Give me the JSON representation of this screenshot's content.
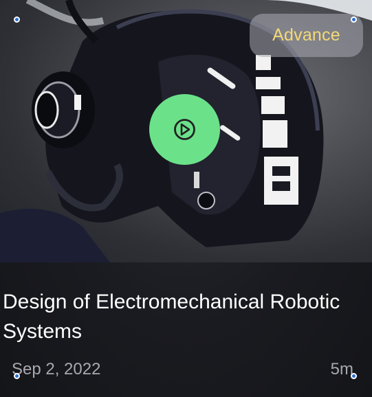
{
  "card": {
    "badge_label": "Advance",
    "title": "Design of Electromechanical Robotic Systems",
    "date": "Sep 2, 2022",
    "duration": "5m"
  },
  "icons": {
    "play": "play-icon"
  },
  "colors": {
    "badge_text": "#f4d976",
    "badge_bg": "#aaaab2",
    "play_button": "#6be28a",
    "title_text": "#ffffff",
    "meta_text": "#a7a9ae",
    "handle": "#2a6fd6"
  }
}
